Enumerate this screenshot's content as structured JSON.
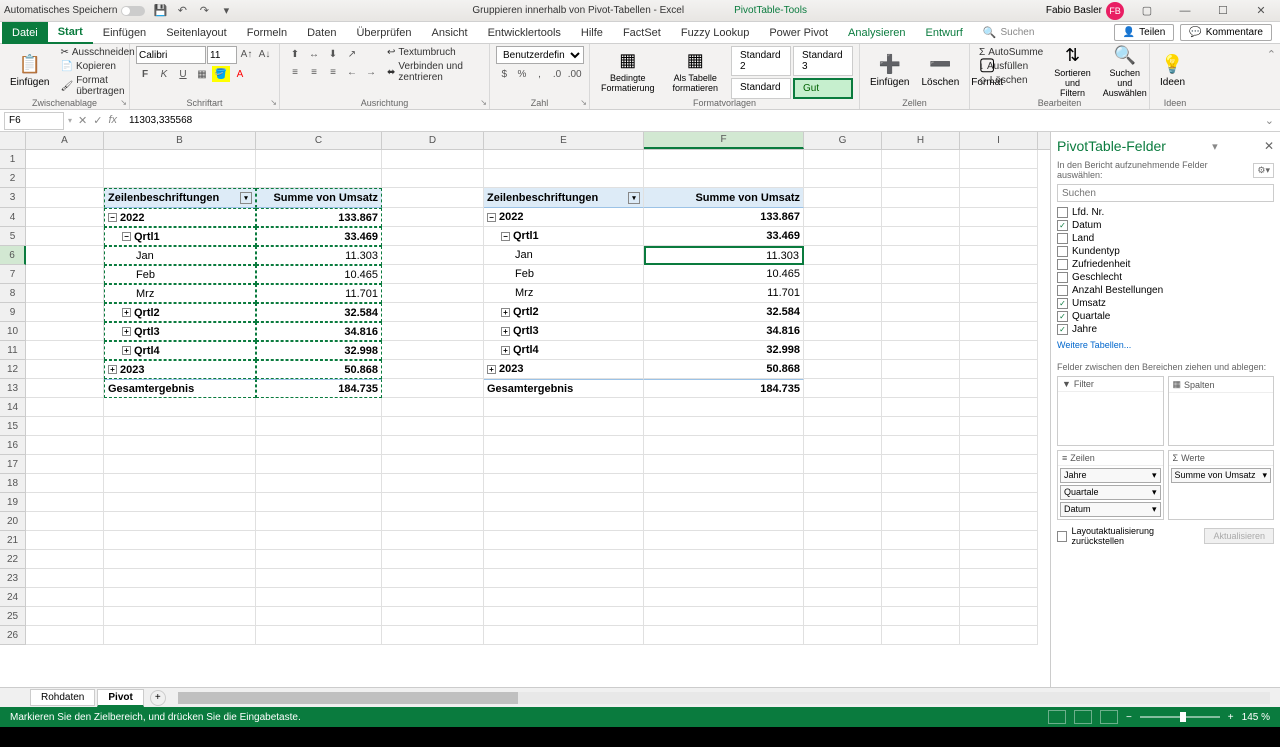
{
  "titlebar": {
    "autosave": "Automatisches Speichern",
    "doc_title": "Gruppieren innerhalb von Pivot-Tabellen  -  Excel",
    "tools_title": "PivotTable-Tools",
    "user_name": "Fabio Basler",
    "user_initials": "FB"
  },
  "ribbon": {
    "tabs": [
      "Datei",
      "Start",
      "Einfügen",
      "Seitenlayout",
      "Formeln",
      "Daten",
      "Überprüfen",
      "Ansicht",
      "Entwicklertools",
      "Hilfe",
      "FactSet",
      "Fuzzy Lookup",
      "Power Pivot",
      "Analysieren",
      "Entwurf"
    ],
    "search_label": "Suchen",
    "share": "Teilen",
    "comments": "Kommentare",
    "clipboard": {
      "label": "Zwischenablage",
      "paste": "Einfügen",
      "cut": "Ausschneiden",
      "copy": "Kopieren",
      "format": "Format übertragen"
    },
    "font": {
      "label": "Schriftart",
      "name": "Calibri",
      "size": "11"
    },
    "align": {
      "label": "Ausrichtung",
      "wrap": "Textumbruch",
      "merge": "Verbinden und zentrieren"
    },
    "number": {
      "label": "Zahl",
      "format": "Benutzerdefiniert"
    },
    "styles": {
      "label": "Formatvorlagen",
      "cond": "Bedingte Formatierung",
      "astable": "Als Tabelle formatieren",
      "s1": "Standard 2",
      "s2": "Standard 3",
      "s3": "Standard",
      "s4": "Gut"
    },
    "cells": {
      "label": "Zellen",
      "insert": "Einfügen",
      "delete": "Löschen",
      "format": "Format"
    },
    "editing": {
      "label": "Bearbeiten",
      "sum": "AutoSumme",
      "fill": "Ausfüllen",
      "clear": "Löschen",
      "sort": "Sortieren und Filtern",
      "find": "Suchen und Auswählen"
    },
    "ideas": {
      "label": "Ideen",
      "btn": "Ideen"
    }
  },
  "formula_bar": {
    "name_box": "F6",
    "value": "11303,335568"
  },
  "columns": [
    "A",
    "B",
    "C",
    "D",
    "E",
    "F",
    "G",
    "H",
    "I"
  ],
  "pivot1": {
    "row_label": "Zeilenbeschriftungen",
    "val_label": "Summe von Umsatz",
    "rows": [
      {
        "r": 4,
        "lvl": 0,
        "exp": "-",
        "label": "2022",
        "val": "133.867"
      },
      {
        "r": 5,
        "lvl": 1,
        "exp": "-",
        "label": "Qrtl1",
        "val": "33.469"
      },
      {
        "r": 6,
        "lvl": 2,
        "exp": "",
        "label": "Jan",
        "val": "11.303"
      },
      {
        "r": 7,
        "lvl": 2,
        "exp": "",
        "label": "Feb",
        "val": "10.465"
      },
      {
        "r": 8,
        "lvl": 2,
        "exp": "",
        "label": "Mrz",
        "val": "11.701"
      },
      {
        "r": 9,
        "lvl": 1,
        "exp": "+",
        "label": "Qrtl2",
        "val": "32.584"
      },
      {
        "r": 10,
        "lvl": 1,
        "exp": "+",
        "label": "Qrtl3",
        "val": "34.816"
      },
      {
        "r": 11,
        "lvl": 1,
        "exp": "+",
        "label": "Qrtl4",
        "val": "32.998"
      },
      {
        "r": 12,
        "lvl": 0,
        "exp": "+",
        "label": "2023",
        "val": "50.868"
      }
    ],
    "total_label": "Gesamtergebnis",
    "total_val": "184.735"
  },
  "pivot2": {
    "row_label": "Zeilenbeschriftungen",
    "val_label": "Summe von Umsatz",
    "rows": [
      {
        "r": 4,
        "lvl": 0,
        "exp": "-",
        "label": "2022",
        "val": "133.867"
      },
      {
        "r": 5,
        "lvl": 1,
        "exp": "-",
        "label": "Qrtl1",
        "val": "33.469"
      },
      {
        "r": 6,
        "lvl": 2,
        "exp": "",
        "label": "Jan",
        "val": "11.303"
      },
      {
        "r": 7,
        "lvl": 2,
        "exp": "",
        "label": "Feb",
        "val": "10.465"
      },
      {
        "r": 8,
        "lvl": 2,
        "exp": "",
        "label": "Mrz",
        "val": "11.701"
      },
      {
        "r": 9,
        "lvl": 1,
        "exp": "+",
        "label": "Qrtl2",
        "val": "32.584"
      },
      {
        "r": 10,
        "lvl": 1,
        "exp": "+",
        "label": "Qrtl3",
        "val": "34.816"
      },
      {
        "r": 11,
        "lvl": 1,
        "exp": "+",
        "label": "Qrtl4",
        "val": "32.998"
      },
      {
        "r": 12,
        "lvl": 0,
        "exp": "+",
        "label": "2023",
        "val": "50.868"
      }
    ],
    "total_label": "Gesamtergebnis",
    "total_val": "184.735"
  },
  "field_pane": {
    "title": "PivotTable-Felder",
    "subtitle": "In den Bericht aufzunehmende Felder auswählen:",
    "search_placeholder": "Suchen",
    "fields": [
      {
        "name": "Lfd. Nr.",
        "checked": false
      },
      {
        "name": "Datum",
        "checked": true
      },
      {
        "name": "Land",
        "checked": false
      },
      {
        "name": "Kundentyp",
        "checked": false
      },
      {
        "name": "Zufriedenheit",
        "checked": false
      },
      {
        "name": "Geschlecht",
        "checked": false
      },
      {
        "name": "Anzahl Bestellungen",
        "checked": false
      },
      {
        "name": "Umsatz",
        "checked": true
      },
      {
        "name": "Quartale",
        "checked": true
      },
      {
        "name": "Jahre",
        "checked": true
      }
    ],
    "more": "Weitere Tabellen...",
    "areas_label": "Felder zwischen den Bereichen ziehen und ablegen:",
    "filter": "Filter",
    "cols": "Spalten",
    "rows": "Zeilen",
    "vals": "Werte",
    "row_items": [
      "Jahre",
      "Quartale",
      "Datum"
    ],
    "val_items": [
      "Summe von Umsatz"
    ],
    "defer": "Layoutaktualisierung zurückstellen",
    "update": "Aktualisieren"
  },
  "sheets": {
    "tabs": [
      "Rohdaten",
      "Pivot"
    ],
    "active": 1
  },
  "status": {
    "msg": "Markieren Sie den Zielbereich, und drücken Sie die Eingabetaste.",
    "zoom": "145 %"
  }
}
